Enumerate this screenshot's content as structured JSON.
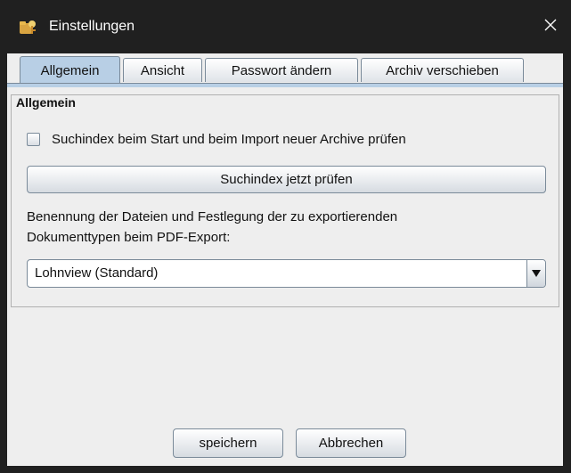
{
  "window": {
    "title": "Einstellungen",
    "icon": "folder-key-icon",
    "close_icon": "close-icon"
  },
  "tabs": [
    {
      "label": "Allgemein",
      "active": true
    },
    {
      "label": "Ansicht",
      "active": false
    },
    {
      "label": "Passwort ändern",
      "active": false
    },
    {
      "label": "Archiv verschieben",
      "active": false
    }
  ],
  "general": {
    "heading": "Allgemein",
    "checkbox_label": "Suchindex beim Start und beim Import neuer Archive prüfen",
    "checkbox_checked": false,
    "check_now_button": "Suchindex jetzt prüfen",
    "description_line1": "Benennung der Dateien und Festlegung der zu exportierenden",
    "description_line2": "Dokumenttypen beim PDF-Export:",
    "export_profile_selected": "Lohnview (Standard)"
  },
  "footer": {
    "save_button": "speichern",
    "cancel_button": "Abbrechen"
  },
  "colors": {
    "titlebar": "#202020",
    "client": "#eeeeee",
    "active_tab": "#b8cfe5",
    "border": "#7a8a99"
  }
}
